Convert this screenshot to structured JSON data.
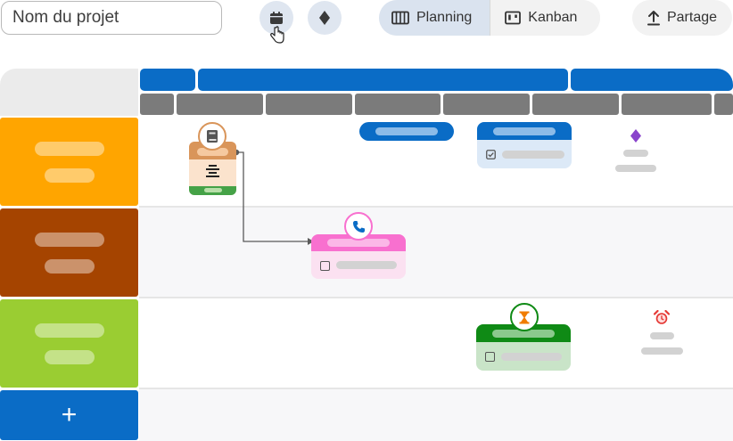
{
  "toolbar": {
    "project_placeholder": "Nom du projet",
    "planning_label": "Planning",
    "kanban_label": "Kanban",
    "share_label": "Partage"
  },
  "add_lane_label": "+",
  "colors": {
    "accent_blue": "#0a6cc6",
    "lane_orange": "#ffa500",
    "lane_brown": "#a54400",
    "lane_green": "#9acd32",
    "milestone_purple": "#8a44cc",
    "alarm_red": "#e53935"
  },
  "icons": {
    "calendar": "calendar-icon",
    "milestone": "diamond-icon",
    "planning": "columns-icon",
    "kanban": "kanban-icon",
    "share": "upload-icon"
  }
}
